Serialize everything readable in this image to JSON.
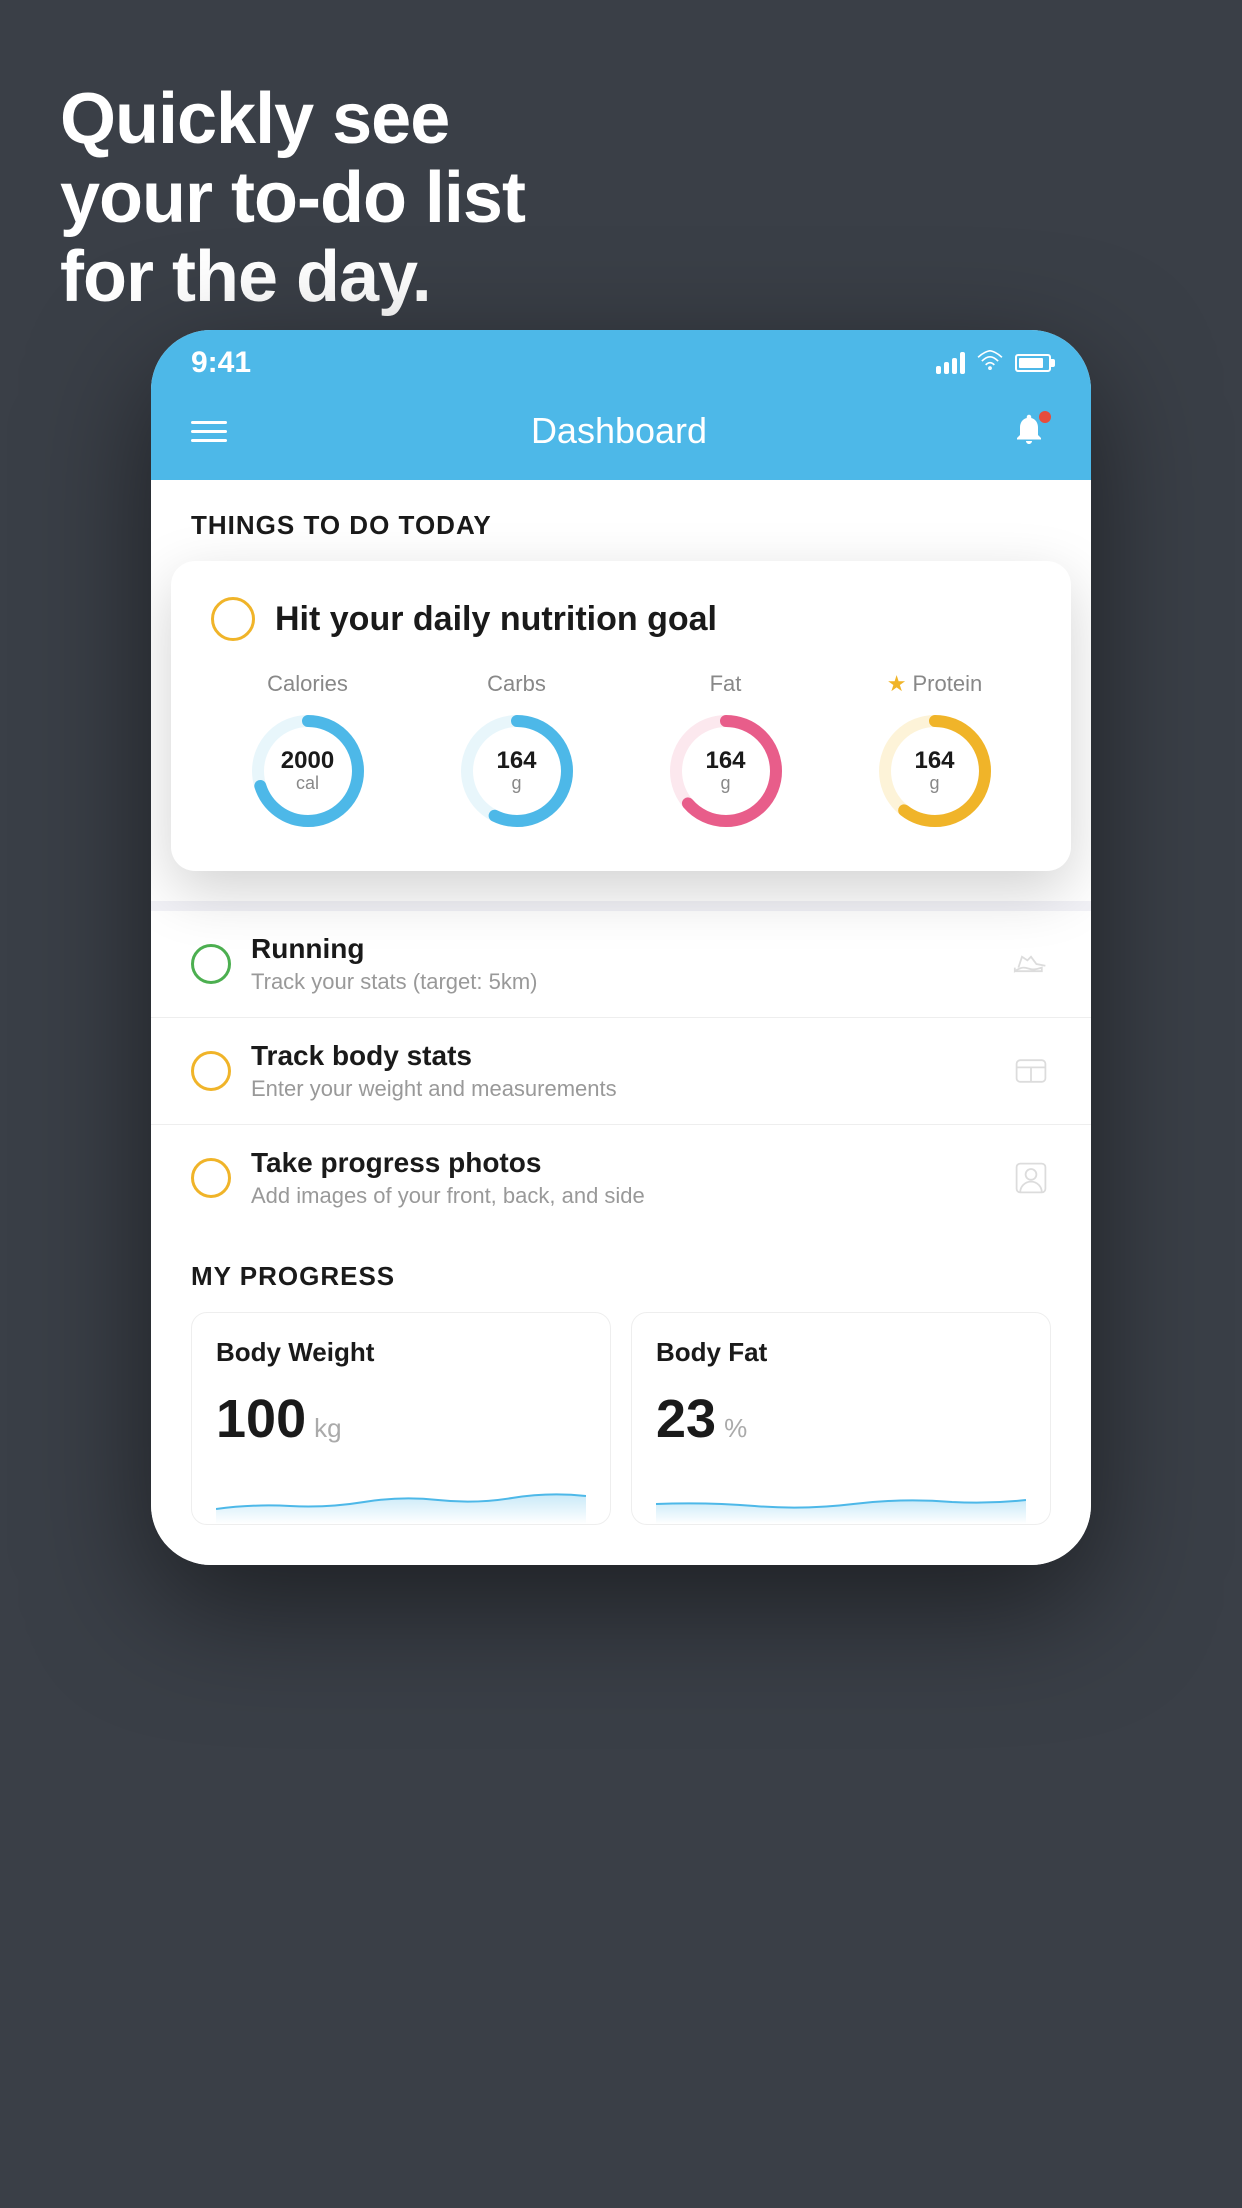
{
  "hero": {
    "line1": "Quickly see",
    "line2": "your to-do list",
    "line3": "for the day."
  },
  "phone": {
    "statusBar": {
      "time": "9:41"
    },
    "header": {
      "title": "Dashboard"
    },
    "sectionHeading": "THINGS TO DO TODAY",
    "popup": {
      "title": "Hit your daily nutrition goal",
      "nutrition": [
        {
          "label": "Calories",
          "value": "2000",
          "unit": "cal",
          "color": "#4db8e8",
          "starred": false
        },
        {
          "label": "Carbs",
          "value": "164",
          "unit": "g",
          "color": "#4db8e8",
          "starred": false
        },
        {
          "label": "Fat",
          "value": "164",
          "unit": "g",
          "color": "#e85d8a",
          "starred": false
        },
        {
          "label": "Protein",
          "value": "164",
          "unit": "g",
          "color": "#f0b429",
          "starred": true
        }
      ]
    },
    "todoItems": [
      {
        "title": "Running",
        "subtitle": "Track your stats (target: 5km)",
        "circleColor": "green",
        "icon": "shoe"
      },
      {
        "title": "Track body stats",
        "subtitle": "Enter your weight and measurements",
        "circleColor": "yellow",
        "icon": "scale"
      },
      {
        "title": "Take progress photos",
        "subtitle": "Add images of your front, back, and side",
        "circleColor": "yellow",
        "icon": "person"
      }
    ],
    "progressSection": {
      "heading": "MY PROGRESS",
      "cards": [
        {
          "title": "Body Weight",
          "value": "100",
          "unit": "kg"
        },
        {
          "title": "Body Fat",
          "value": "23",
          "unit": "%"
        }
      ]
    }
  }
}
